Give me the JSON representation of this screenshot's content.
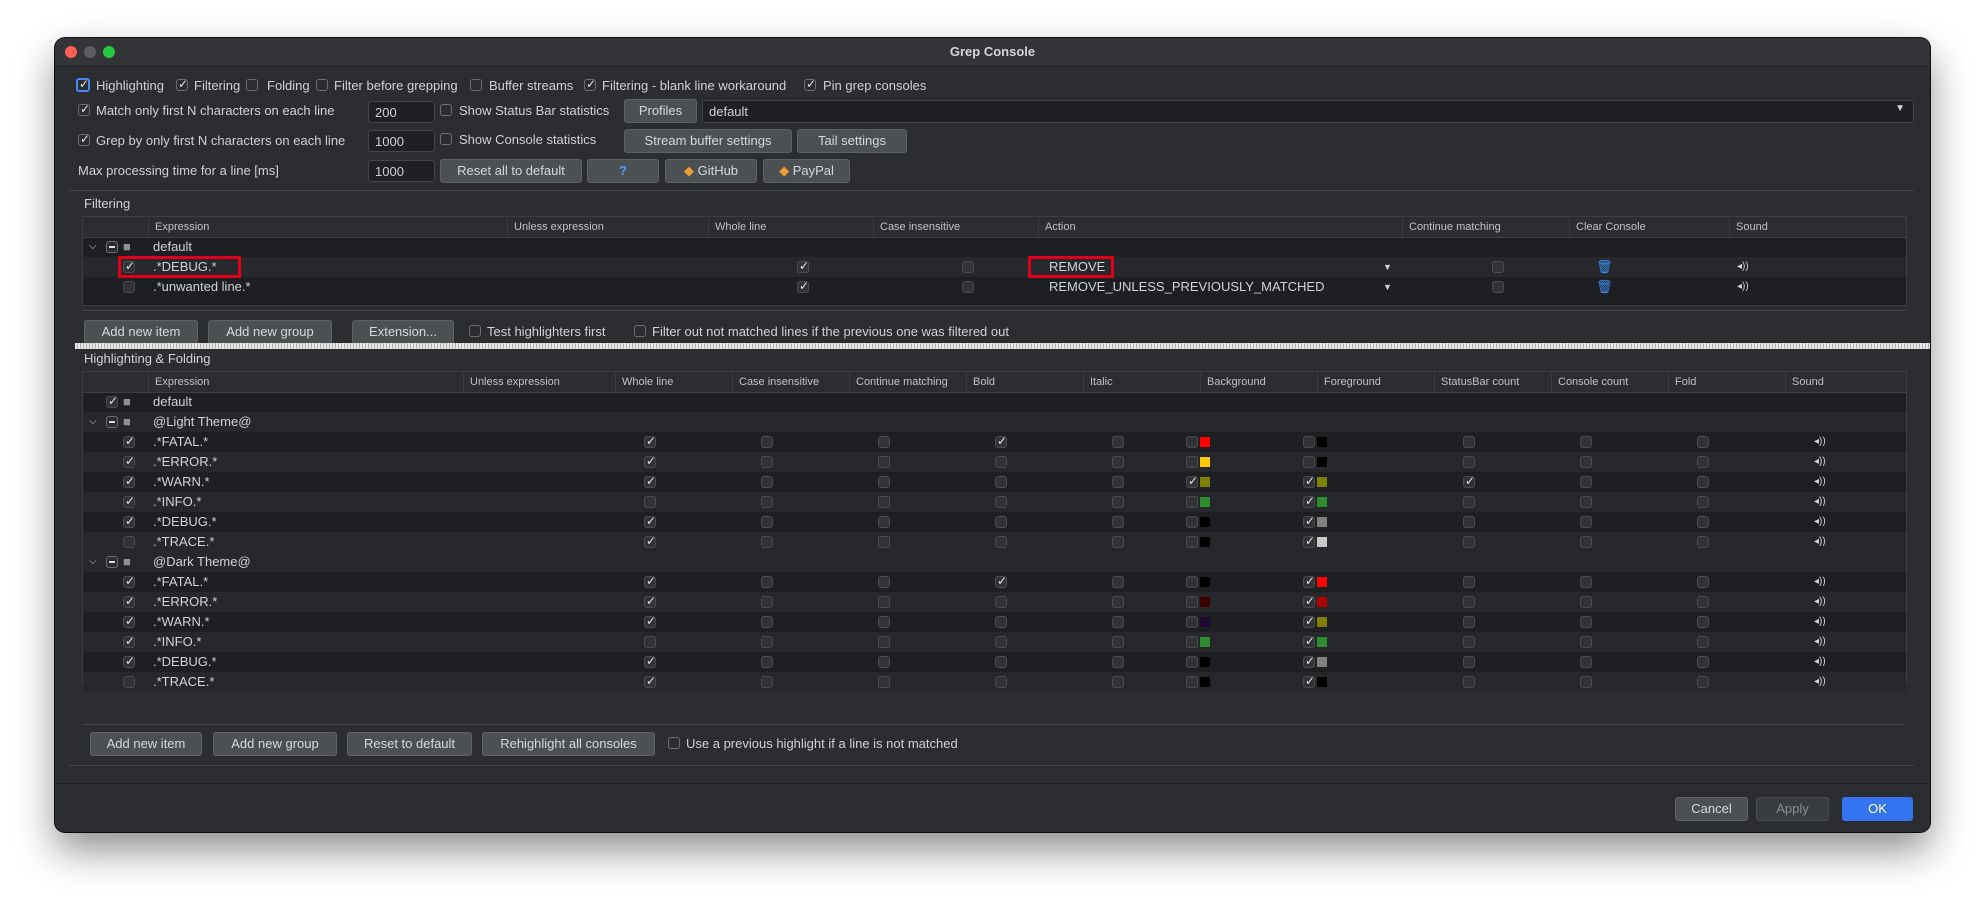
{
  "window": {
    "title": "Grep Console"
  },
  "options": {
    "highlighting": "Highlighting",
    "filtering": "Filtering",
    "folding": "Folding",
    "filter_before_grepping": "Filter before grepping",
    "buffer_streams": "Buffer streams",
    "blank_line_workaround": "Filtering - blank line workaround",
    "pin_grep_consoles": "Pin grep consoles",
    "match_first_n": "Match only first N characters on each line",
    "match_first_n_value": "200",
    "show_status_bar": "Show Status Bar statistics",
    "profiles_btn": "Profiles",
    "profile_value": "default",
    "grep_first_n": "Grep by only first N characters on each line",
    "grep_first_n_value": "1000",
    "show_console_stats": "Show Console statistics",
    "stream_buffer_btn": "Stream buffer settings",
    "tail_btn": "Tail settings",
    "max_processing": "Max processing time for a line [ms]",
    "max_processing_value": "1000",
    "reset_all_btn": "Reset all to default",
    "help_btn": "?",
    "github_btn": "GitHub",
    "paypal_btn": "PayPal"
  },
  "filtering": {
    "section_title": "Filtering",
    "columns": [
      "Expression",
      "Unless expression",
      "Whole line",
      "Case insensitive",
      "Action",
      "Continue matching",
      "Clear Console",
      "Sound"
    ],
    "group": "default",
    "rows": [
      {
        "expr": ".*DEBUG.*",
        "action": "REMOVE"
      },
      {
        "expr": ".*unwanted line.*",
        "action": "REMOVE_UNLESS_PREVIOUSLY_MATCHED"
      }
    ],
    "add_item_btn": "Add new item",
    "add_group_btn": "Add new group",
    "extension_btn": "Extension...",
    "test_first": "Test highlighters first",
    "filter_out_not_matched": "Filter out not matched lines if the previous one was filtered out"
  },
  "highlighting": {
    "section_title": "Highlighting & Folding",
    "columns": [
      "Expression",
      "Unless expression",
      "Whole line",
      "Case insensitive",
      "Continue matching",
      "Bold",
      "Italic",
      "Background",
      "Foreground",
      "StatusBar count",
      "Console count",
      "Fold",
      "Sound"
    ],
    "root": "default",
    "groups": [
      {
        "name": "@Light Theme@",
        "rows": [
          {
            "expr": ".*FATAL.*",
            "bg": "#ff0000",
            "fg": "#000000"
          },
          {
            "expr": ".*ERROR.*",
            "bg": "#ffc800",
            "fg": "#000000"
          },
          {
            "expr": ".*WARN.*",
            "bg": "#808000",
            "fg": "#808000"
          },
          {
            "expr": ".*INFO.*",
            "bg": "#2e8b2e",
            "fg": "#2e8b2e"
          },
          {
            "expr": ".*DEBUG.*",
            "bg": "#000000",
            "fg": "#808080"
          },
          {
            "expr": ".*TRACE.*",
            "bg": "#000000",
            "fg": "#c8c8c8"
          }
        ]
      },
      {
        "name": "@Dark Theme@",
        "rows": [
          {
            "expr": ".*FATAL.*",
            "bg": "#000000",
            "fg": "#ff0000"
          },
          {
            "expr": ".*ERROR.*",
            "bg": "#3a0000",
            "fg": "#b00000"
          },
          {
            "expr": ".*WARN.*",
            "bg": "#1e0a30",
            "fg": "#808000"
          },
          {
            "expr": ".*INFO.*",
            "bg": "#2e8b2e",
            "fg": "#2e8b2e"
          },
          {
            "expr": ".*DEBUG.*",
            "bg": "#000000",
            "fg": "#808080"
          },
          {
            "expr": ".*TRACE.*",
            "bg": "#000000",
            "fg": "#000000"
          }
        ]
      }
    ],
    "add_item_btn": "Add new item",
    "add_group_btn": "Add new group",
    "reset_btn": "Reset to default",
    "rehighlight_btn": "Rehighlight all consoles",
    "use_previous": "Use a previous highlight if a line is not matched"
  },
  "footer": {
    "cancel": "Cancel",
    "apply": "Apply",
    "ok": "OK"
  }
}
